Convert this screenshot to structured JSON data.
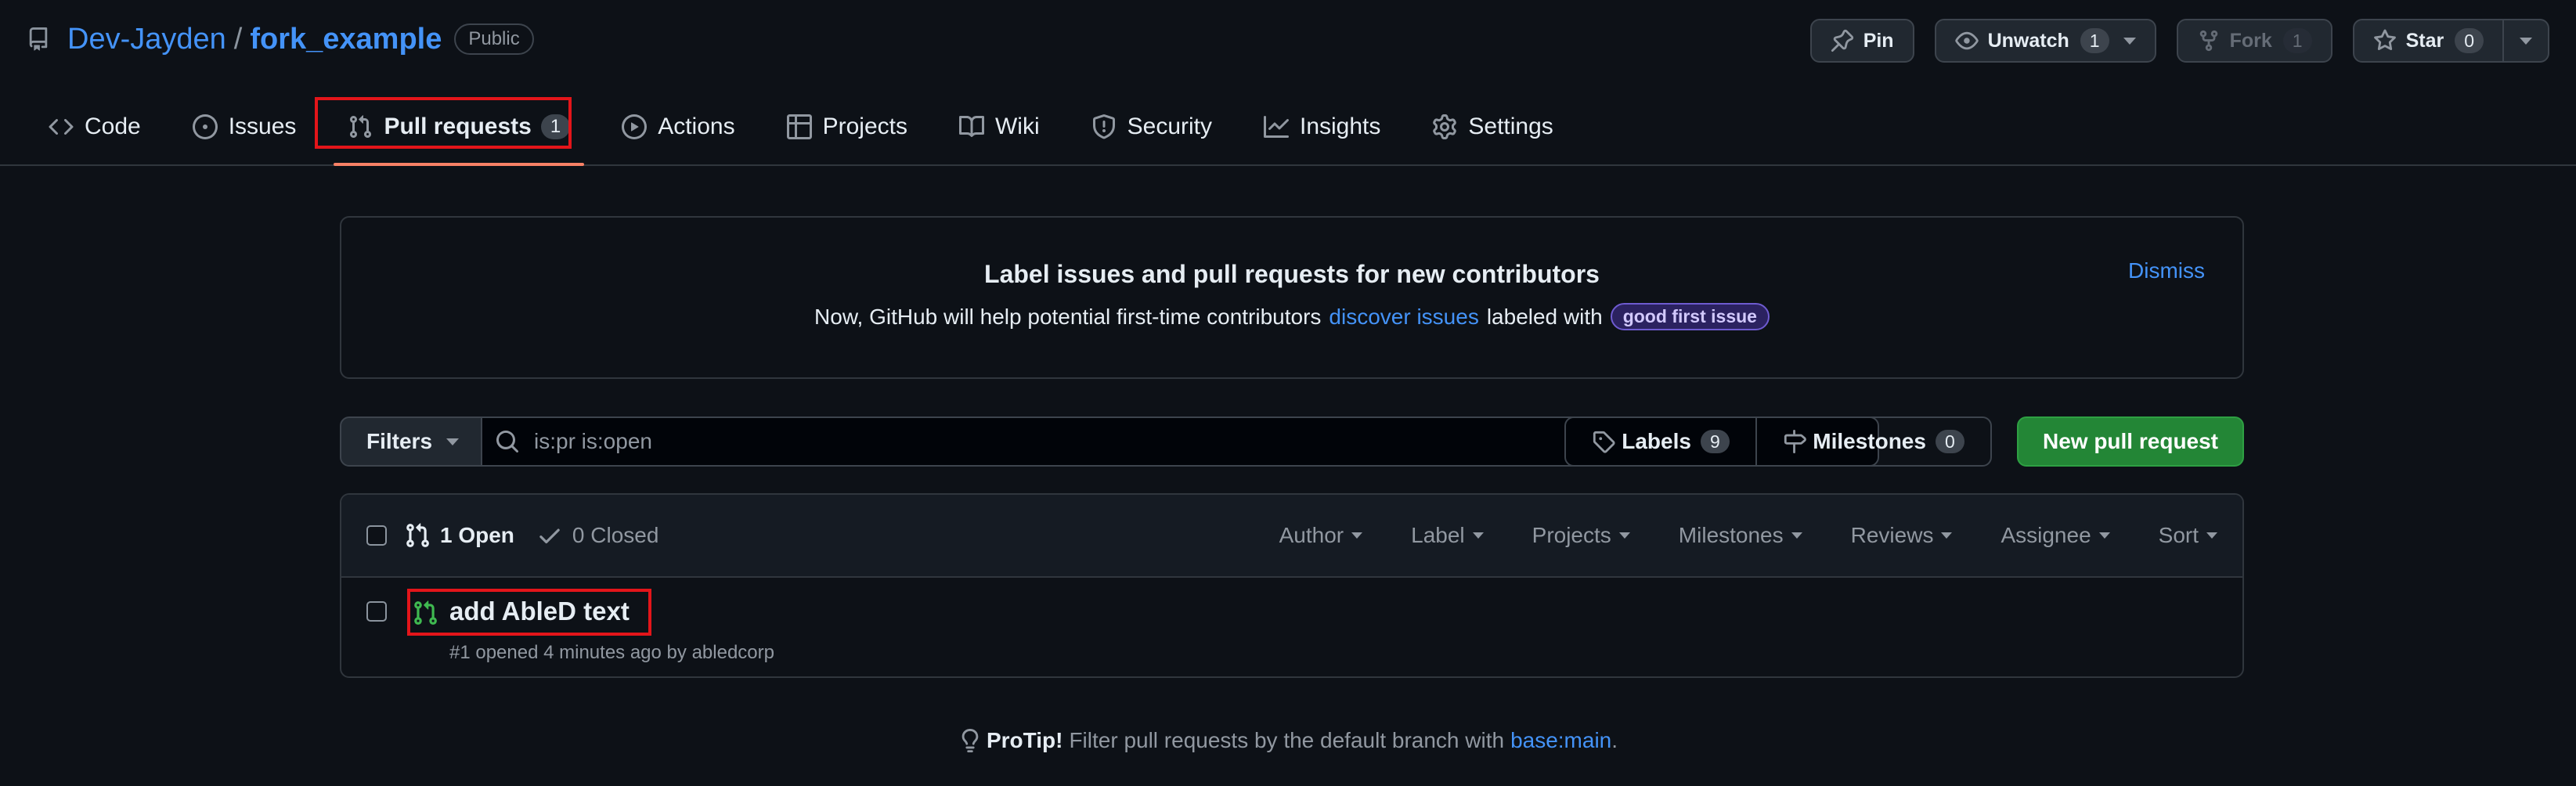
{
  "repo": {
    "owner": "Dev-Jayden",
    "separator": "/",
    "name": "fork_example",
    "visibility": "Public"
  },
  "actions": {
    "pin": "Pin",
    "unwatch": "Unwatch",
    "unwatch_count": "1",
    "fork": "Fork",
    "fork_count": "1",
    "star": "Star",
    "star_count": "0"
  },
  "tabs": [
    {
      "label": "Code",
      "icon": "code-icon"
    },
    {
      "label": "Issues",
      "icon": "issue-opened-icon"
    },
    {
      "label": "Pull requests",
      "icon": "git-pull-request-icon",
      "count": "1",
      "selected": true
    },
    {
      "label": "Actions",
      "icon": "play-icon"
    },
    {
      "label": "Projects",
      "icon": "table-icon"
    },
    {
      "label": "Wiki",
      "icon": "book-icon"
    },
    {
      "label": "Security",
      "icon": "shield-icon"
    },
    {
      "label": "Insights",
      "icon": "graph-icon"
    },
    {
      "label": "Settings",
      "icon": "gear-icon"
    }
  ],
  "banner": {
    "title": "Label issues and pull requests for new contributors",
    "text_before": "Now, GitHub will help potential first-time contributors",
    "link": "discover issues",
    "text_after": "labeled with",
    "label": "good first issue",
    "dismiss": "Dismiss"
  },
  "filterbar": {
    "filters": "Filters",
    "search_value": "is:pr is:open",
    "labels": "Labels",
    "labels_count": "9",
    "milestones": "Milestones",
    "milestones_count": "0",
    "new_pr": "New pull request"
  },
  "list": {
    "open": "1 Open",
    "closed": "0 Closed",
    "sorters": [
      "Author",
      "Label",
      "Projects",
      "Milestones",
      "Reviews",
      "Assignee",
      "Sort"
    ],
    "items": [
      {
        "title": "add AbleD text",
        "meta": "#1 opened 4 minutes ago by abledcorp"
      }
    ]
  },
  "protip": {
    "strong": "ProTip!",
    "text": "Filter pull requests by the default branch with",
    "link": "base:main",
    "end": "."
  },
  "colors": {
    "background": "#0d1117",
    "link": "#4493f8",
    "primary_button": "#238636",
    "selected_underline": "#f78166",
    "highlight_box": "#e3151a",
    "open_pr": "#3fb950"
  }
}
